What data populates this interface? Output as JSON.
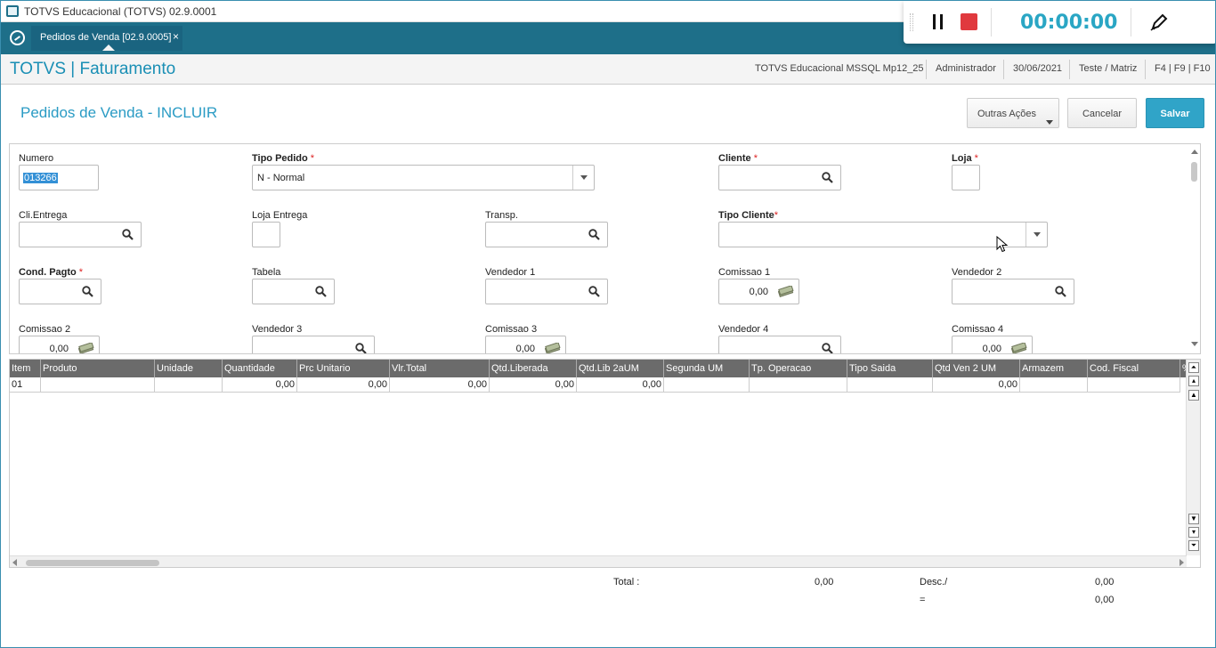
{
  "window": {
    "title": "TOTVS Educacional (TOTVS) 02.9.0001"
  },
  "tab": {
    "label": "Pedidos de Venda [02.9.0005]",
    "close": "×"
  },
  "header": {
    "brand": "TOTVS | Faturamento",
    "environment": "TOTVS Educacional MSSQL Mp12_25",
    "user": "Administrador",
    "date": "30/06/2021",
    "branch": "Teste / Matriz",
    "shortcuts": "F4 | F9 | F10"
  },
  "page": {
    "title": "Pedidos de Venda - INCLUIR"
  },
  "actions": {
    "other": "Outras Ações",
    "cancel": "Cancelar",
    "save": "Salvar"
  },
  "form": {
    "numero": {
      "label": "Numero",
      "value": "013266"
    },
    "tipo_pedido": {
      "label": "Tipo Pedido",
      "required": "*",
      "value": "N - Normal"
    },
    "cliente": {
      "label": "Cliente",
      "required": "*"
    },
    "loja": {
      "label": "Loja",
      "required": "*"
    },
    "cli_entrega": {
      "label": "Cli.Entrega"
    },
    "loja_entrega": {
      "label": "Loja Entrega"
    },
    "transp": {
      "label": "Transp."
    },
    "tipo_cliente": {
      "label": "Tipo Cliente",
      "required": "*"
    },
    "cond_pagto": {
      "label": "Cond. Pagto",
      "required": "*"
    },
    "tabela": {
      "label": "Tabela"
    },
    "vendedor1": {
      "label": "Vendedor 1"
    },
    "comissao1": {
      "label": "Comissao 1",
      "value": "0,00"
    },
    "vendedor2": {
      "label": "Vendedor 2"
    },
    "comissao2": {
      "label": "Comissao 2",
      "value": "0,00"
    },
    "vendedor3": {
      "label": "Vendedor 3"
    },
    "comissao3": {
      "label": "Comissao 3",
      "value": "0,00"
    },
    "vendedor4": {
      "label": "Vendedor 4"
    },
    "comissao4": {
      "label": "Comissao 4",
      "value": "0,00"
    }
  },
  "grid": {
    "columns": [
      "Item",
      "Produto",
      "Unidade",
      "Quantidade",
      "Prc Unitario",
      "Vlr.Total",
      "Qtd.Liberada",
      "Qtd.Lib 2aUM",
      "Segunda UM",
      "Tp. Operacao",
      "Tipo Saida",
      "Qtd Ven 2 UM",
      "Armazem",
      "Cod. Fiscal",
      "%"
    ],
    "rows": [
      [
        "01",
        "",
        "",
        "0,00",
        "0,00",
        "0,00",
        "0,00",
        "0,00",
        "",
        "",
        "",
        "0,00",
        "",
        ""
      ]
    ]
  },
  "totals": {
    "total_label": "Total :",
    "total_value": "0,00",
    "desc_label": "Desc./",
    "desc_value": "0,00",
    "eq_label": "=",
    "eq_value": "0,00"
  },
  "recorder": {
    "time": "00:00:00"
  }
}
